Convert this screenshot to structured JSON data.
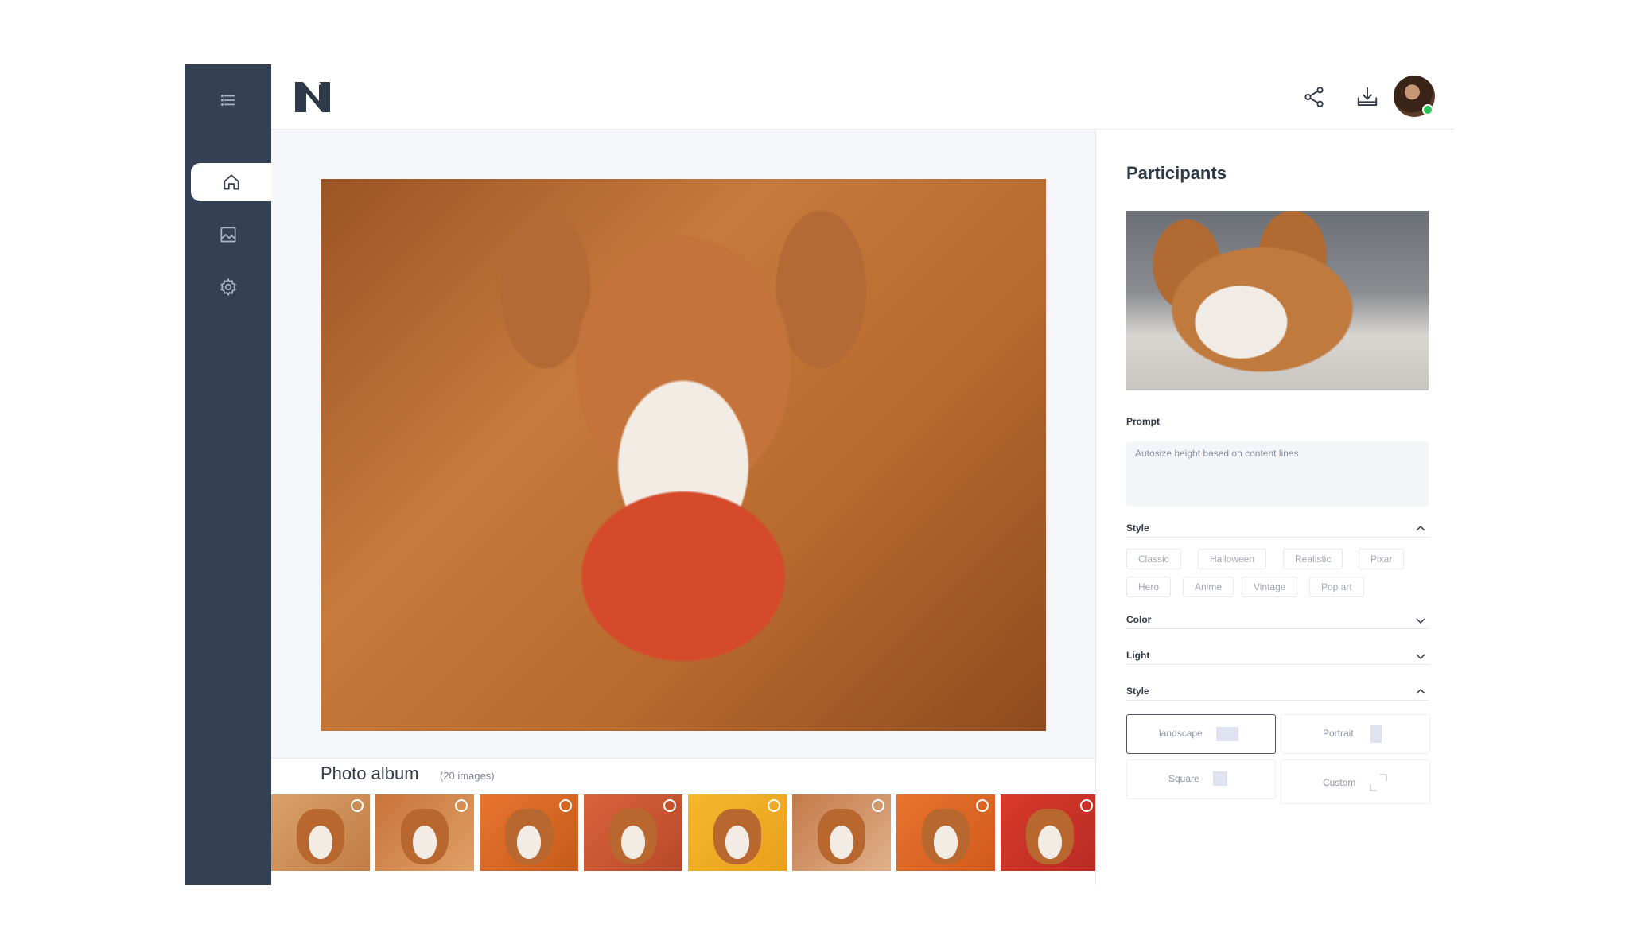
{
  "header": {
    "logo": "N",
    "icons": [
      "share-icon",
      "download-icon"
    ],
    "avatar": "user-avatar",
    "online_color": "#27c45a"
  },
  "sidebar": {
    "items": [
      "menu-icon",
      "home-icon",
      "gallery-icon",
      "settings-icon"
    ],
    "active": "home"
  },
  "album": {
    "title": "Photo album",
    "count": "(20 images)",
    "visible_thumbs": 8
  },
  "panel": {
    "title": "Participants",
    "prompt_label": "Prompt",
    "prompt_placeholder": "Autosize height based on content lines",
    "style_label": "Style",
    "styles": [
      "Classic",
      "Halloween",
      "Realistic",
      "Pixar",
      "Hero",
      "Anime",
      "Vintage",
      "Pop art"
    ],
    "color_label": "Color",
    "light_label": "Light",
    "format_label": "Style",
    "formats": [
      "landscape",
      "Portrait",
      "Square",
      "Custom"
    ],
    "selected_format": "landscape"
  },
  "colors": {
    "sidebar": "#334152",
    "accent_border": "#4a5462",
    "background": "#f5f7fa"
  }
}
